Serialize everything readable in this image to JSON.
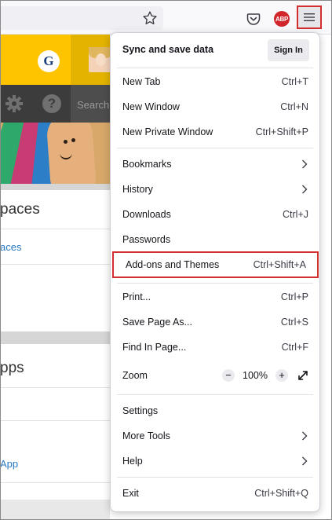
{
  "background_page": {
    "logo_letter": "G",
    "search_placeholder": "Search",
    "section1_title": "paces",
    "section1_link": "aces",
    "section2_title": "pps",
    "section2_link": "App"
  },
  "toolbar": {
    "abp_label": "ABP"
  },
  "menu": {
    "sync_title": "Sync and save data",
    "sign_in": "Sign In",
    "items": [
      {
        "label": "New Tab",
        "shortcut": "Ctrl+T"
      },
      {
        "label": "New Window",
        "shortcut": "Ctrl+N"
      },
      {
        "label": "New Private Window",
        "shortcut": "Ctrl+Shift+P"
      },
      {
        "label": "Bookmarks",
        "shortcut": ""
      },
      {
        "label": "History",
        "shortcut": ""
      },
      {
        "label": "Downloads",
        "shortcut": "Ctrl+J"
      },
      {
        "label": "Passwords",
        "shortcut": ""
      },
      {
        "label": "Add-ons and Themes",
        "shortcut": "Ctrl+Shift+A"
      },
      {
        "label": "Print...",
        "shortcut": "Ctrl+P"
      },
      {
        "label": "Save Page As...",
        "shortcut": "Ctrl+S"
      },
      {
        "label": "Find In Page...",
        "shortcut": "Ctrl+F"
      },
      {
        "label": "Zoom",
        "shortcut": ""
      },
      {
        "label": "Settings",
        "shortcut": ""
      },
      {
        "label": "More Tools",
        "shortcut": ""
      },
      {
        "label": "Help",
        "shortcut": ""
      },
      {
        "label": "Exit",
        "shortcut": "Ctrl+Shift+Q"
      }
    ],
    "zoom": {
      "minus": "−",
      "value": "100%",
      "plus": "+"
    }
  },
  "colors": {
    "highlight": "#d32f2f",
    "link": "#2a78c2",
    "brand_yellow": "#ffc400"
  }
}
